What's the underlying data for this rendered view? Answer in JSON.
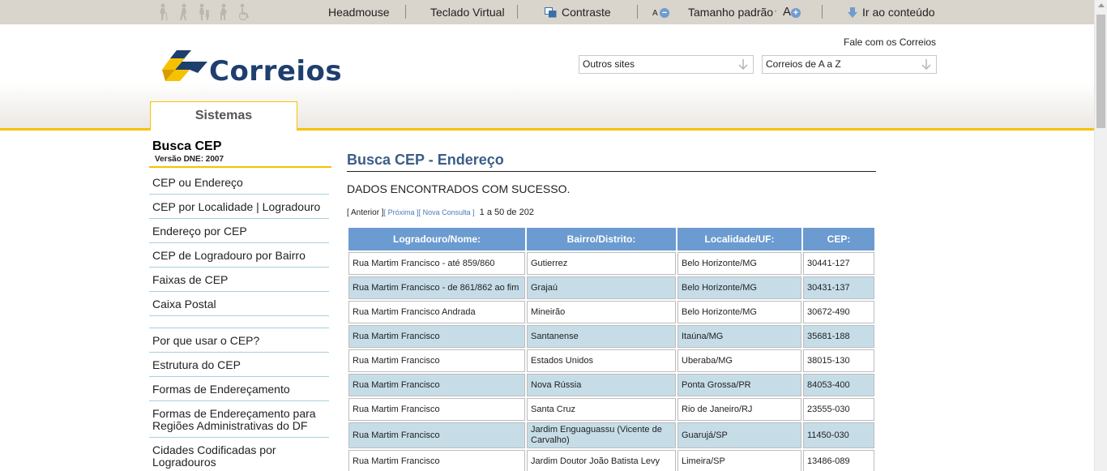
{
  "accessibility_bar": {
    "icons": [
      "elderly-person-icon",
      "walking-person-icon",
      "adult-with-child-icon",
      "pregnant-person-icon",
      "wheelchair-icon"
    ],
    "headmouse": "Headmouse",
    "teclado": "Teclado Virtual",
    "contraste": "Contraste",
    "font_small": "A",
    "font_default": "Tamanho padrão",
    "font_large": "A",
    "ir_conteudo": "Ir ao conteúdo"
  },
  "header": {
    "logo_text": "Correios",
    "fale": "Fale com os Correios",
    "outros_sites": "Outros sites",
    "correios_az": "Correios de A a Z",
    "tab": "Sistemas"
  },
  "sidebar": {
    "title": "Busca CEP",
    "subtitle": "Versão DNE: 2007",
    "items": [
      "CEP ou Endereço",
      "CEP por Localidade | Logradouro",
      "Endereço por CEP",
      "CEP de Logradouro por Bairro",
      "Faixas de CEP",
      "Caixa Postal",
      "",
      "Por que usar o CEP?",
      "Estrutura do CEP",
      "Formas de Endereçamento",
      "Formas de Endereçamento para Regiões Administrativas do DF",
      "Cidades Codificadas por Logradouros"
    ]
  },
  "main": {
    "title": "Busca CEP - Endereço",
    "status": "DADOS ENCONTRADOS COM SUCESSO.",
    "pager": {
      "anterior": "[ Anterior ]",
      "proxima": "[ Próxima ]",
      "nova": "[ Nova Consulta ]",
      "count": "1 a 50 de 202"
    },
    "columns": [
      "Logradouro/Nome:",
      "Bairro/Distrito:",
      "Localidade/UF:",
      "CEP:"
    ],
    "rows": [
      [
        "Rua Martim Francisco - até 859/860",
        "Gutierrez",
        "Belo Horizonte/MG",
        "30441-127"
      ],
      [
        "Rua Martim Francisco - de 861/862 ao fim",
        "Grajaú",
        "Belo Horizonte/MG",
        "30431-137"
      ],
      [
        "Rua Martim Francisco Andrada",
        "Mineirão",
        "Belo Horizonte/MG",
        "30672-490"
      ],
      [
        "Rua Martim Francisco",
        "Santanense",
        "Itaúna/MG",
        "35681-188"
      ],
      [
        "Rua Martim Francisco",
        "Estados Unidos",
        "Uberaba/MG",
        "38015-130"
      ],
      [
        "Rua Martim Francisco",
        "Nova Rússia",
        "Ponta Grossa/PR",
        "84053-400"
      ],
      [
        "Rua Martim Francisco",
        "Santa Cruz",
        "Rio de Janeiro/RJ",
        "23555-030"
      ],
      [
        "Rua Martim Francisco",
        "Jardim Enguaguassu (Vicente de Carvalho)",
        "Guarujá/SP",
        "11450-030"
      ],
      [
        "Rua Martim Francisco",
        "Jardim Doutor João Batista Levy",
        "Limeira/SP",
        "13486-089"
      ]
    ]
  },
  "colors": {
    "accent_yellow": "#f6c200",
    "header_blue": "#6b9bd0",
    "row_alt": "#c6dde8",
    "title_blue": "#3c5d88"
  }
}
